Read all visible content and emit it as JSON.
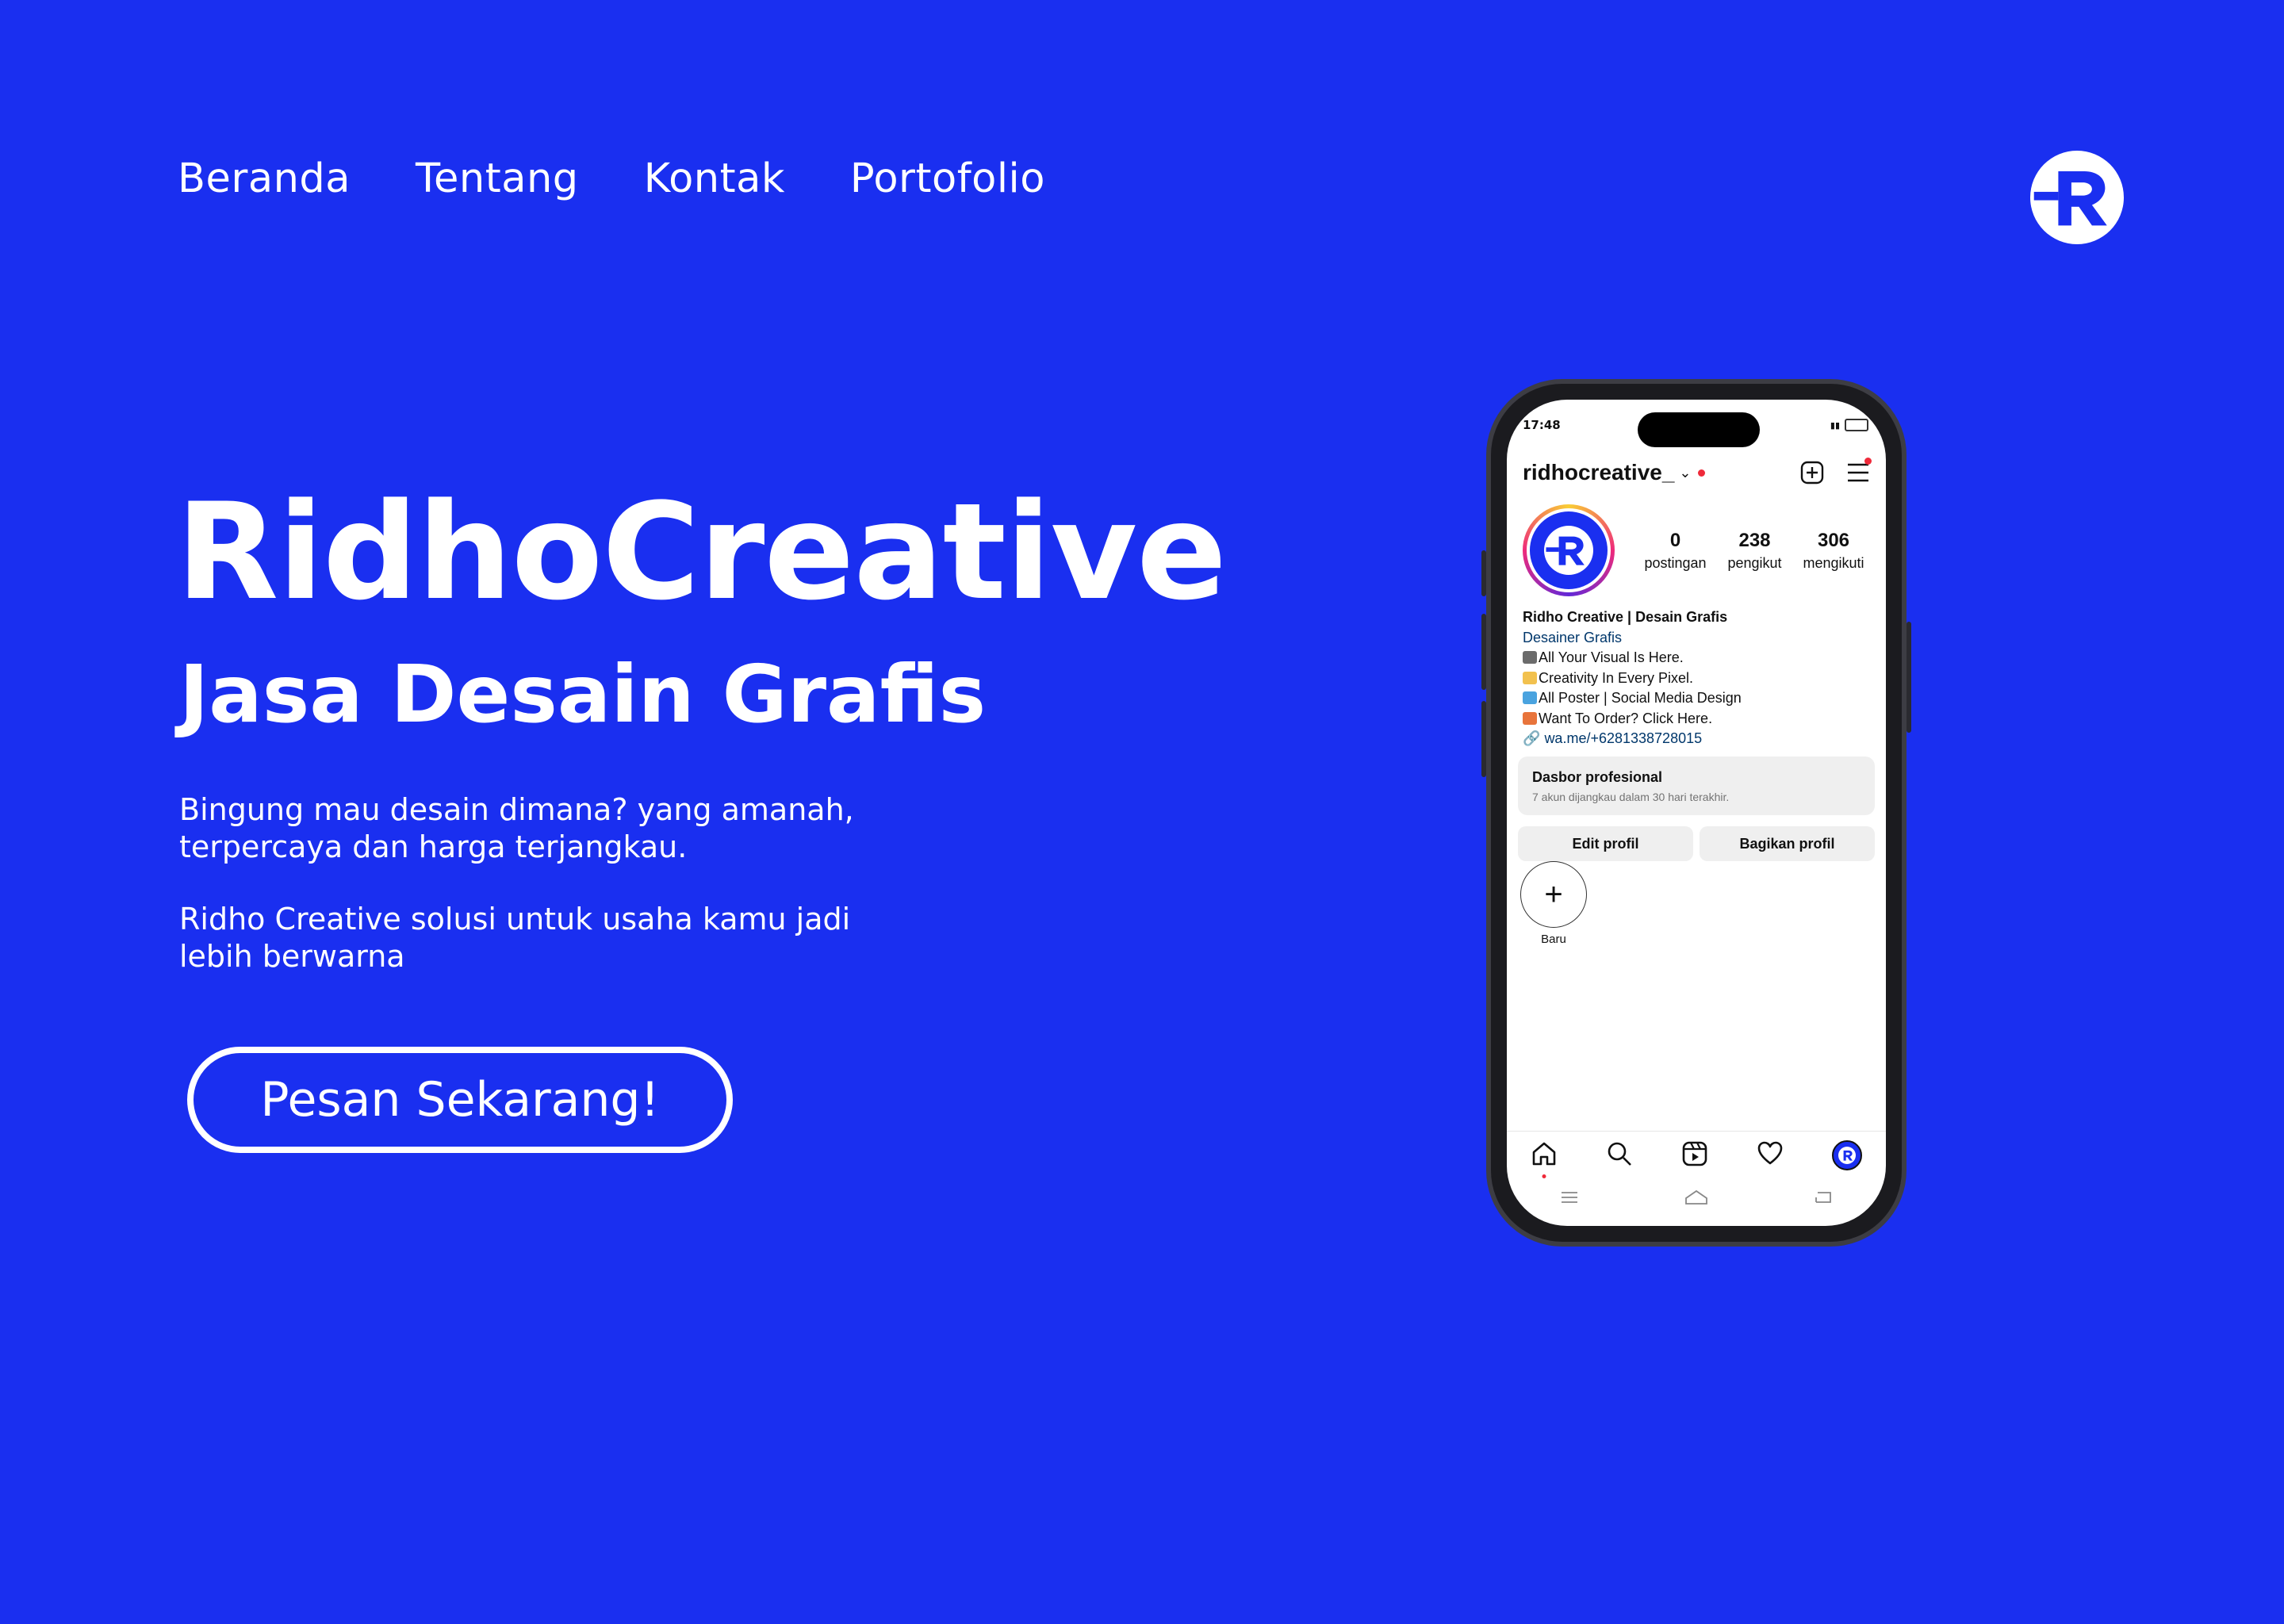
{
  "nav": {
    "items": [
      "Beranda",
      "Tentang",
      "Kontak",
      "Portofolio"
    ]
  },
  "brand": {
    "logo_icon": "r-logo-icon"
  },
  "hero": {
    "title": "RidhoCreative",
    "subtitle": "Jasa Desain Grafis",
    "desc1_line1": "Bingung mau desain dimana? yang amanah,",
    "desc1_line2": "terpercaya dan harga terjangkau.",
    "desc2_line1": "Ridho Creative solusi untuk usaha kamu jadi",
    "desc2_line2": "lebih berwarna",
    "cta": "Pesan Sekarang!"
  },
  "colors": {
    "background": "#1a2ff0",
    "text": "#ffffff",
    "notification": "#ef2a3a"
  },
  "phone": {
    "status": {
      "time": "17:48"
    },
    "profile": {
      "username": "ridhocreative_",
      "stats": [
        {
          "value": "0",
          "label": "postingan"
        },
        {
          "value": "238",
          "label": "pengikut"
        },
        {
          "value": "306",
          "label": "mengikuti"
        }
      ],
      "name": "Ridho Creative | Desain Grafis",
      "category": "Desainer Grafis",
      "bio": [
        "All Your Visual Is Here.",
        "Creativity In Every Pixel.",
        "All Poster | Social Media Design",
        "Want To Order? Click Here."
      ],
      "link": "wa.me/+6281338728015",
      "dashboard_title": "Dasbor profesional",
      "dashboard_sub": "7 akun dijangkau dalam 30 hari terakhir.",
      "edit_button": "Edit profil",
      "share_button": "Bagikan profil",
      "new_story_label": "Baru"
    }
  }
}
